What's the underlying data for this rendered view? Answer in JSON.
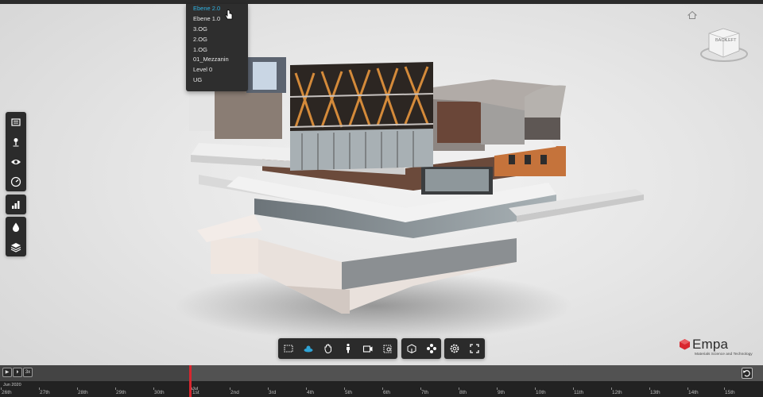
{
  "level_dropdown": {
    "items": [
      "Ebene 2.0",
      "Ebene 1.0",
      "3.OG",
      "2.OG",
      "1.OG",
      "01_Mezzanin",
      "Level 0",
      "UG"
    ],
    "selected": "Ebene 2.0"
  },
  "left_toolbar": {
    "group1": [
      "list-icon",
      "map-pin-icon",
      "eye-icon",
      "gauge-icon"
    ],
    "group2": [
      "building-chart-icon"
    ],
    "group3": [
      "water-drop-icon",
      "layers-icon"
    ]
  },
  "nav_cube": {
    "faces": [
      "BACK",
      "LEFT"
    ]
  },
  "bottom_toolbar": {
    "group1": [
      "box-select-icon",
      "orbit-icon",
      "pan-hand-icon",
      "walk-person-icon",
      "camera-icon",
      "section-box-icon"
    ],
    "group2": [
      "model-tree-icon",
      "properties-icon"
    ],
    "group3": [
      "settings-icon",
      "fullscreen-icon"
    ]
  },
  "logo": {
    "name": "Empa",
    "tagline": "Materials Science and Technology",
    "color": "#d8262e"
  },
  "timeline": {
    "controls": [
      "play",
      "step",
      "3x"
    ],
    "speed_label": "3x",
    "month_label": "Jun 2020",
    "current_label": "Jul",
    "current_day": "1st",
    "marker_color": "#d8262e",
    "ticks": [
      "26th",
      "27th",
      "28th",
      "29th",
      "30th",
      "1st",
      "2nd",
      "3rd",
      "4th",
      "5th",
      "6th",
      "7th",
      "8th",
      "9th",
      "10th",
      "11th",
      "12th",
      "13th",
      "14th",
      "15th"
    ]
  }
}
